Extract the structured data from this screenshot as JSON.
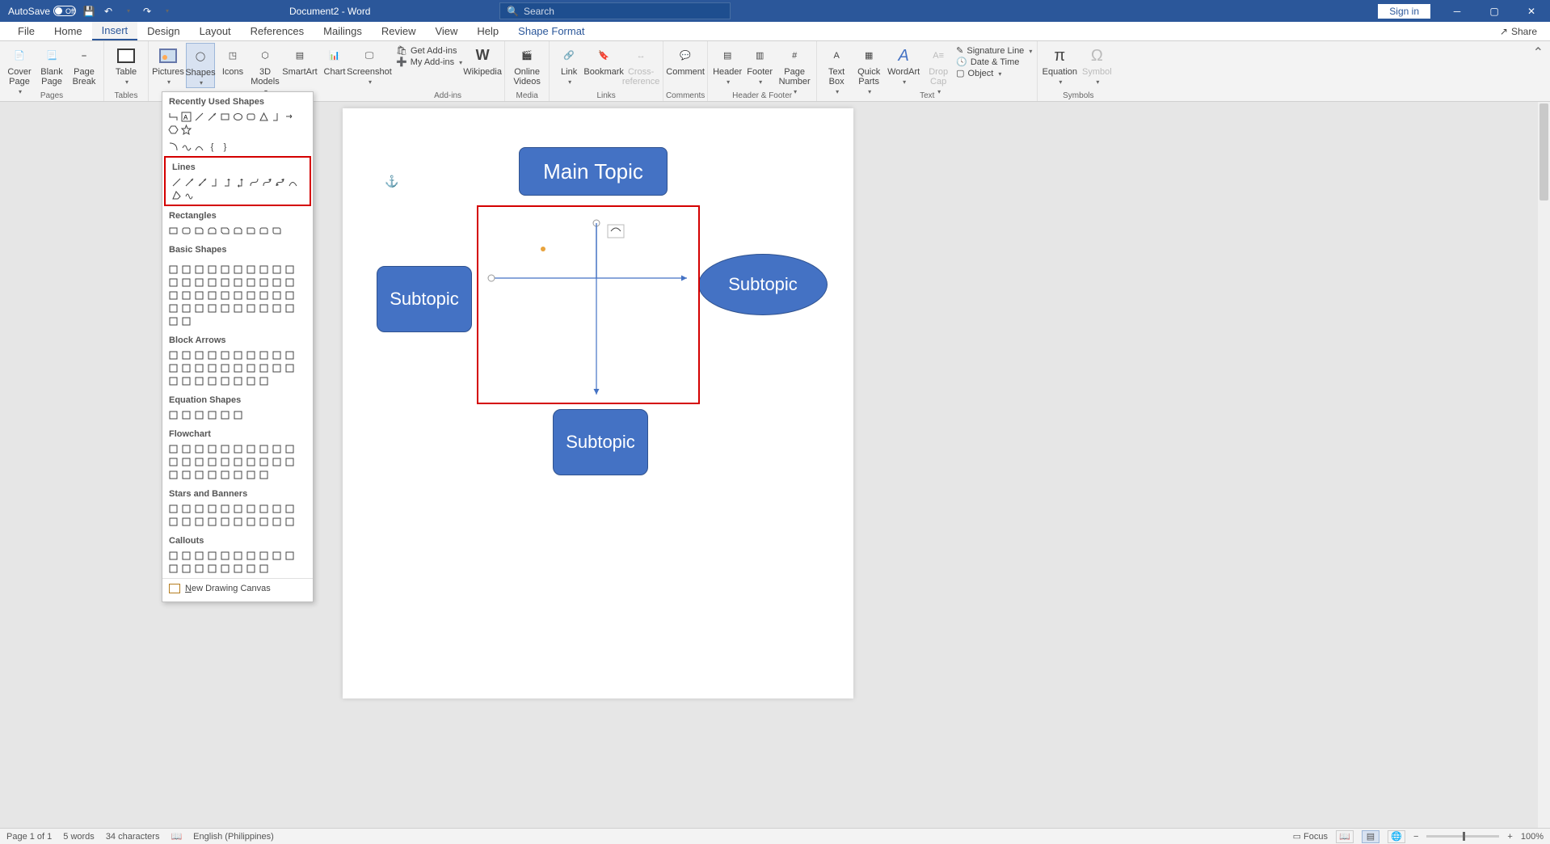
{
  "titlebar": {
    "autosave_label": "AutoSave",
    "autosave_state": "Off",
    "doc_title": "Document2 - Word",
    "search_placeholder": "Search",
    "signin": "Sign in"
  },
  "tabs": {
    "file": "File",
    "home": "Home",
    "insert": "Insert",
    "design": "Design",
    "layout": "Layout",
    "references": "References",
    "mailings": "Mailings",
    "review": "Review",
    "view": "View",
    "help": "Help",
    "shape_format": "Shape Format",
    "share": "Share"
  },
  "ribbon": {
    "pages": {
      "label": "Pages",
      "cover": "Cover Page",
      "blank": "Blank Page",
      "break": "Page Break"
    },
    "tables": {
      "label": "Tables",
      "table": "Table"
    },
    "illustrations": {
      "pictures": "Pictures",
      "shapes": "Shapes",
      "icons": "Icons",
      "models": "3D Models",
      "smartart": "SmartArt",
      "chart": "Chart",
      "screenshot": "Screenshot"
    },
    "addins": {
      "label": "Add-ins",
      "get": "Get Add-ins",
      "my": "My Add-ins",
      "wiki": "Wikipedia"
    },
    "media": {
      "label": "Media",
      "online": "Online Videos"
    },
    "links": {
      "label": "Links",
      "link": "Link",
      "bookmark": "Bookmark",
      "xref": "Cross-reference"
    },
    "comments": {
      "label": "Comments",
      "comment": "Comment"
    },
    "hf": {
      "label": "Header & Footer",
      "header": "Header",
      "footer": "Footer",
      "page_number": "Page Number"
    },
    "text": {
      "label": "Text",
      "textbox": "Text Box",
      "quick": "Quick Parts",
      "wordart": "WordArt",
      "dropcap": "Drop Cap",
      "sig": "Signature Line",
      "datetime": "Date & Time",
      "object": "Object"
    },
    "symbols": {
      "label": "Symbols",
      "equation": "Equation",
      "symbol": "Symbol"
    }
  },
  "shapes_dropdown": {
    "recent": "Recently Used Shapes",
    "lines": "Lines",
    "rectangles": "Rectangles",
    "basic": "Basic Shapes",
    "arrows": "Block Arrows",
    "equation": "Equation Shapes",
    "flowchart": "Flowchart",
    "stars": "Stars and Banners",
    "callouts": "Callouts",
    "new_canvas": "New Drawing Canvas"
  },
  "canvas": {
    "main_topic": "Main Topic",
    "subtopic1": "Subtopic",
    "subtopic2": "Subtopic",
    "subtopic3": "Subtopic"
  },
  "status": {
    "page": "Page 1 of 1",
    "words": "5 words",
    "chars": "34 characters",
    "lang": "English (Philippines)",
    "focus": "Focus",
    "zoom": "100%"
  }
}
